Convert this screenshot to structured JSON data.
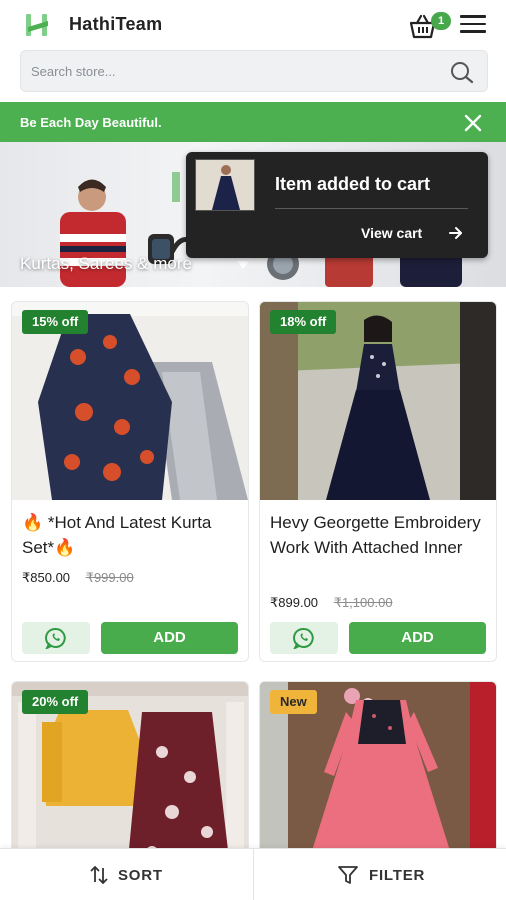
{
  "header": {
    "brand": "HathiTeam",
    "cart_count": "1",
    "icons": {
      "logo": "hathi-logo-icon",
      "cart": "basket-icon",
      "menu": "hamburger-icon"
    }
  },
  "search": {
    "placeholder": "Search store...",
    "value": ""
  },
  "announcement": {
    "text": "Be Each Day Beautiful.",
    "close_icon": "close-icon"
  },
  "hero": {
    "label": "Kurtas, Sarees & more"
  },
  "toast": {
    "title": "Item added to cart",
    "link": "View cart"
  },
  "products": [
    {
      "badge": "15% off",
      "title": "🔥 *Hot And Latest Kurta Set*🔥",
      "price": "₹850.00",
      "mrp": "₹999.00",
      "add_label": "ADD"
    },
    {
      "badge": "18% off",
      "title": "Hevy Georgette Embroidery Work With Attached Inner",
      "price": "₹899.00",
      "mrp": "₹1,100.00",
      "add_label": "ADD"
    },
    {
      "badge": "20% off"
    },
    {
      "badge": "New"
    }
  ],
  "bottom_bar": {
    "sort_label": "SORT",
    "filter_label": "FILTER"
  },
  "colors": {
    "accent": "#4cb050",
    "badge_green": "#23822f",
    "badge_new": "#f0b43a",
    "toast_bg": "#232323"
  }
}
